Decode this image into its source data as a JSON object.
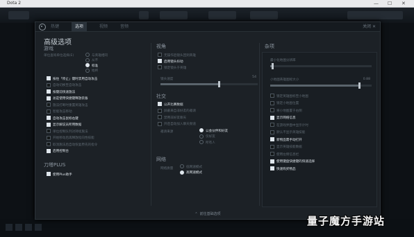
{
  "window": {
    "title": "Dota 2",
    "controls": [
      "—",
      "☐",
      "✕"
    ]
  },
  "tabs": [
    {
      "label": "热键",
      "active": false
    },
    {
      "label": "选项",
      "active": true
    },
    {
      "label": "视频",
      "active": false
    },
    {
      "label": "音频",
      "active": false
    }
  ],
  "close_label": "关闭 ✕",
  "page_title": "高级选项",
  "game": {
    "header": "游戏",
    "unit_query_label": "单位查询单位选择(E)",
    "unit_query_options": [
      {
        "label": "与英雄相同",
        "on": false
      },
      {
        "label": "从不",
        "on": false
      },
      {
        "label": "标准",
        "on": true
      },
      {
        "label": "始终",
        "on": false
      }
    ],
    "checkboxes": [
      {
        "label": "按住「停止」键时禁用自动攻击",
        "on": true
      },
      {
        "label": "自动切换至自动攻击",
        "on": false
      },
      {
        "label": "按键前快速施法",
        "on": true
      },
      {
        "label": "总是使用快捷键释放装备",
        "on": true
      },
      {
        "label": "施法打断时重置英雄攻击",
        "on": false
      },
      {
        "label": "智能攻击移动",
        "on": false
      },
      {
        "label": "自动攻击鼠标右键",
        "on": true
      },
      {
        "label": "显示解说员所用数据",
        "on": true
      },
      {
        "label": "单位控制队列对持续施法",
        "on": false
      },
      {
        "label": "开始移动后再释放指向性技能",
        "on": false
      },
      {
        "label": "取消施法后自动恢复原先的指令",
        "on": false
      },
      {
        "label": "启用控制台",
        "on": true
      }
    ]
  },
  "dota_plus": {
    "header": "刀塔PLUS",
    "checkboxes": [
      {
        "label": "使用Plus助手",
        "on": true
      }
    ]
  },
  "camera": {
    "header": "视角",
    "checkboxes": [
      {
        "label": "无操作后镜头回到英雄",
        "on": false
      },
      {
        "label": "启用镜头抖动",
        "on": true
      },
      {
        "label": "锁定镜头于英雄",
        "on": false
      }
    ],
    "slider": {
      "label": "镜头速度",
      "value": "54",
      "fraction": 0.6
    }
  },
  "social": {
    "header": "社交",
    "checkboxes": [
      {
        "label": "公开比赛数据",
        "on": true
      },
      {
        "label": "屏蔽来自非好友的邀请",
        "on": false
      },
      {
        "label": "禁用非好友聊天",
        "on": false
      },
      {
        "label": "开启自动加入聊天频道",
        "on": false
      }
    ],
    "invite_label": "邀请来源",
    "invite_options": [
      {
        "label": "公会伙伴和好友",
        "on": true
      },
      {
        "label": "仅好友",
        "on": false
      },
      {
        "label": "所有人",
        "on": false
      }
    ]
  },
  "network": {
    "header": "网络",
    "quality_label": "网络质量",
    "options": [
      {
        "label": "低网速模式",
        "on": false
      },
      {
        "label": "高网速模式",
        "on": true
      }
    ]
  },
  "misc": {
    "header": "杂项",
    "slider1": {
      "label": "最小化地图分辨率",
      "value": "",
      "fraction": 0.02
    },
    "slider2": {
      "label": "小地图英雄图标大小",
      "value": "0.88",
      "fraction": 0.88
    },
    "checkboxes": [
      {
        "label": "锁定英雄图标至小地图",
        "on": false
      },
      {
        "label": "锁定小地图位置",
        "on": false
      },
      {
        "label": "将小地图置于右侧",
        "on": false
      },
      {
        "label": "显示网络信息",
        "on": true
      },
      {
        "label": "在游戏界面中显示计时",
        "on": false
      },
      {
        "label": "默认不显示英雄技能",
        "on": false
      },
      {
        "label": "新物品需手动打开",
        "on": true
      },
      {
        "label": "显示英雄技能数据",
        "on": false
      },
      {
        "label": "使用左侧信息栏",
        "on": false
      },
      {
        "label": "使用键盘快捷键的快速选择",
        "on": true
      },
      {
        "label": "快速购买物品",
        "on": true
      }
    ]
  },
  "footer": {
    "arrow": "⌃",
    "label": "前往基础选项"
  },
  "watermark": "量子魔方手游站"
}
